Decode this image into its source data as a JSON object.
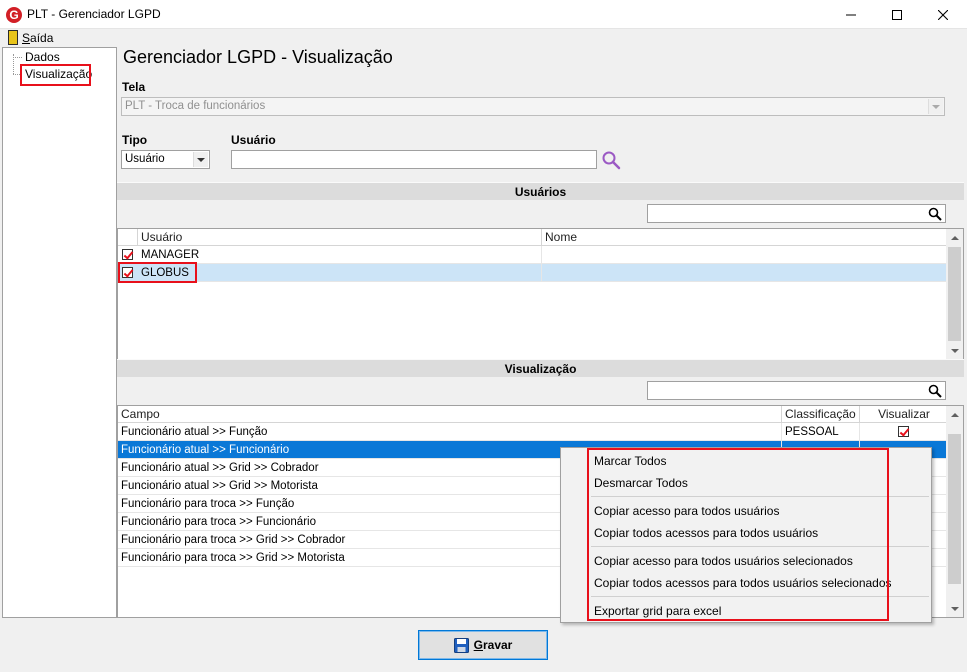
{
  "window": {
    "logo_letter": "G",
    "title": "PLT - Gerenciador LGPD"
  },
  "menu": {
    "exit_label": "Saída"
  },
  "tree": {
    "items": [
      {
        "label": "Dados"
      },
      {
        "label": "Visualização"
      }
    ]
  },
  "main": {
    "page_title": "Gerenciador LGPD - Visualização",
    "screen_label": "Tela",
    "screen_value": "PLT - Troca de funcionários",
    "type_label": "Tipo",
    "type_value": "Usuário",
    "user_label": "Usuário",
    "user_value": ""
  },
  "users_section": {
    "title": "Usuários",
    "search_value": "",
    "columns": [
      "Usuário",
      "Nome"
    ],
    "rows": [
      {
        "user": "MANAGER",
        "name": "",
        "checked": true
      },
      {
        "user": "GLOBUS",
        "name": "",
        "checked": true
      }
    ]
  },
  "view_section": {
    "title": "Visualização",
    "search_value": "",
    "columns": [
      "Campo",
      "Classificação",
      "Visualizar"
    ],
    "rows": [
      {
        "field": "Funcionário atual >> Função",
        "classification": "PESSOAL",
        "visible": true
      },
      {
        "field": "Funcionário atual >> Funcionário",
        "classification": "",
        "visible": true
      },
      {
        "field": "Funcionário atual >> Grid >> Cobrador",
        "classification": "",
        "visible": false
      },
      {
        "field": "Funcionário atual >> Grid >> Motorista",
        "classification": "",
        "visible": false
      },
      {
        "field": "Funcionário para troca >> Função",
        "classification": "",
        "visible": false
      },
      {
        "field": "Funcionário para troca >> Funcionário",
        "classification": "",
        "visible": false
      },
      {
        "field": "Funcionário para troca >> Grid >> Cobrador",
        "classification": "",
        "visible": false
      },
      {
        "field": "Funcionário para troca >> Grid >> Motorista",
        "classification": "",
        "visible": false
      }
    ]
  },
  "context_menu": {
    "items": [
      "Marcar Todos",
      "Desmarcar Todos",
      "Copiar acesso para todos usuários",
      "Copiar todos acessos para todos usuários",
      "Copiar acesso para todos usuários selecionados",
      "Copiar todos acessos para todos usuários selecionados",
      "Exportar grid para excel"
    ]
  },
  "footer": {
    "save_label": "Gravar"
  },
  "colors": {
    "highlight_red": "#e8101b",
    "selection_blue": "#0a78d7",
    "search_purple": "#9b59c4",
    "logo_red": "#d21f26"
  }
}
